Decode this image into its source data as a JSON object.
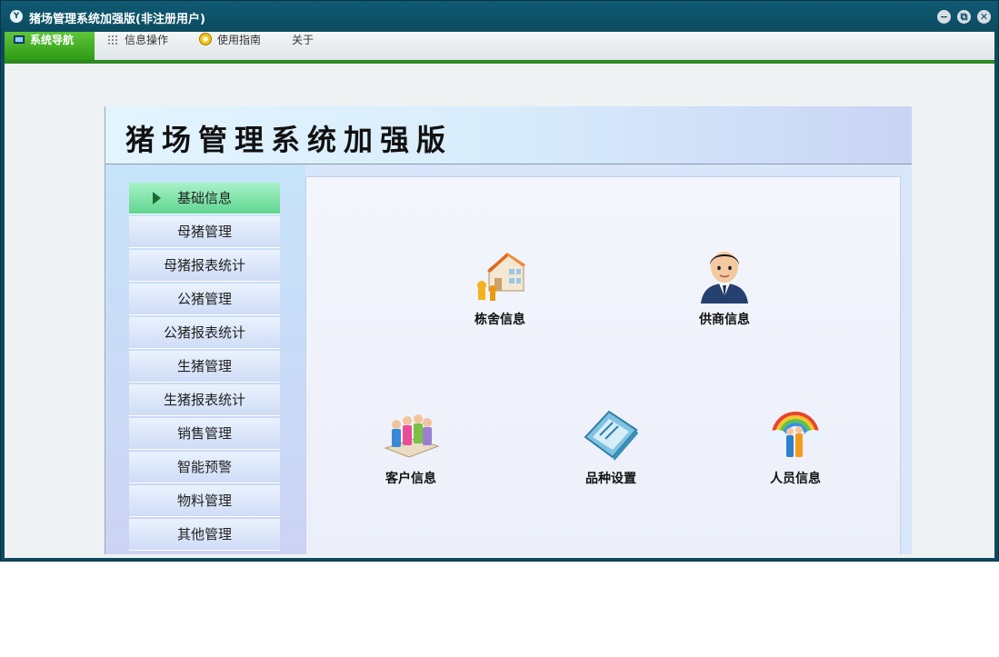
{
  "window": {
    "title": "猪场管理系统加强版(非注册用户)",
    "app_icon_letter": "Y",
    "controls": {
      "minimize": "−",
      "restore": "⧉",
      "close": "✕"
    }
  },
  "menubar": {
    "items": [
      {
        "label": "系统导航",
        "icon": "monitor-icon",
        "active": true
      },
      {
        "label": "信息操作",
        "icon": "grid-icon",
        "active": false
      },
      {
        "label": "使用指南",
        "icon": "help-circle-icon",
        "active": false
      },
      {
        "label": "关于",
        "icon": "",
        "active": false
      }
    ]
  },
  "banner": {
    "title": "猪场管理系统加强版"
  },
  "nav": {
    "items": [
      {
        "label": "基础信息",
        "active": true
      },
      {
        "label": "母猪管理"
      },
      {
        "label": "母猪报表统计"
      },
      {
        "label": "公猪管理"
      },
      {
        "label": "公猪报表统计"
      },
      {
        "label": "生猪管理"
      },
      {
        "label": "生猪报表统计"
      },
      {
        "label": "销售管理"
      },
      {
        "label": "智能预警"
      },
      {
        "label": "物料管理"
      },
      {
        "label": "其他管理"
      }
    ]
  },
  "tiles": [
    {
      "label": "栋舍信息",
      "icon": "building-icon"
    },
    {
      "label": "供商信息",
      "icon": "businessman-icon"
    },
    {
      "label": "客户信息",
      "icon": "customer-group-icon"
    },
    {
      "label": "品种设置",
      "icon": "book-icon"
    },
    {
      "label": "人员信息",
      "icon": "rainbow-people-icon"
    }
  ],
  "colors": {
    "titlebar": "#0c4c61",
    "menu_active": "#3aa81f",
    "menu_underline": "#2d8a1e",
    "nav_active": "#7ee3a8"
  }
}
